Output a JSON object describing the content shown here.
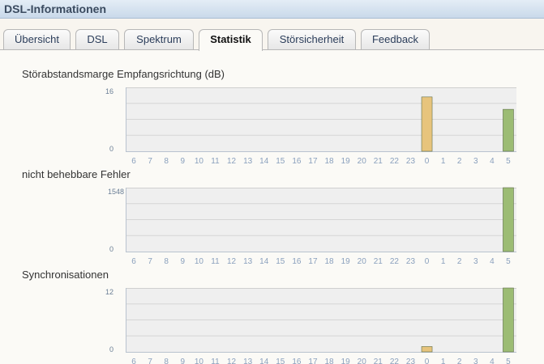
{
  "window_title": "DSL-Informationen",
  "tabs": [
    {
      "label": "Übersicht",
      "active": false
    },
    {
      "label": "DSL",
      "active": false
    },
    {
      "label": "Spektrum",
      "active": false
    },
    {
      "label": "Statistik",
      "active": true
    },
    {
      "label": "Störsicherheit",
      "active": false
    },
    {
      "label": "Feedback",
      "active": false
    }
  ],
  "colors": {
    "bar_orange": "#e7c47c",
    "bar_green": "#9cbc74",
    "plot_bg": "#efefef",
    "tick_text": "#8aa0bd",
    "axis_text": "#6b7f96"
  },
  "charts": [
    {
      "title": "Störabstandsmarge Empfangsrichtung (dB)",
      "ymax_label": "16",
      "ymin_label": "0"
    },
    {
      "title": "nicht behebbare Fehler",
      "ymax_label": "1548",
      "ymin_label": "0"
    },
    {
      "title": "Synchronisationen",
      "ymax_label": "12",
      "ymin_label": "0"
    }
  ],
  "chart_data": [
    {
      "type": "bar",
      "title": "Störabstandsmarge Empfangsrichtung (dB)",
      "categories": [
        "6",
        "7",
        "8",
        "9",
        "10",
        "11",
        "12",
        "13",
        "14",
        "15",
        "16",
        "17",
        "18",
        "19",
        "20",
        "21",
        "22",
        "23",
        "0",
        "1",
        "2",
        "3",
        "4",
        "5"
      ],
      "values": [
        null,
        null,
        null,
        null,
        null,
        null,
        null,
        null,
        null,
        null,
        null,
        null,
        null,
        null,
        null,
        null,
        null,
        null,
        13.6,
        null,
        null,
        null,
        null,
        10.5
      ],
      "bar_colors": {
        "0": "#e7c47c",
        "5": "#9cbc74"
      },
      "ylim": [
        0,
        16
      ]
    },
    {
      "type": "bar",
      "title": "nicht behebbare Fehler",
      "categories": [
        "6",
        "7",
        "8",
        "9",
        "10",
        "11",
        "12",
        "13",
        "14",
        "15",
        "16",
        "17",
        "18",
        "19",
        "20",
        "21",
        "22",
        "23",
        "0",
        "1",
        "2",
        "3",
        "4",
        "5"
      ],
      "values": [
        null,
        null,
        null,
        null,
        null,
        null,
        null,
        null,
        null,
        null,
        null,
        null,
        null,
        null,
        null,
        null,
        null,
        null,
        0,
        null,
        null,
        null,
        null,
        1548
      ],
      "bar_colors": {
        "0": "#e7c47c",
        "5": "#9cbc74"
      },
      "ylim": [
        0,
        1548
      ]
    },
    {
      "type": "bar",
      "title": "Synchronisationen",
      "categories": [
        "6",
        "7",
        "8",
        "9",
        "10",
        "11",
        "12",
        "13",
        "14",
        "15",
        "16",
        "17",
        "18",
        "19",
        "20",
        "21",
        "22",
        "23",
        "0",
        "1",
        "2",
        "3",
        "4",
        "5"
      ],
      "values": [
        null,
        null,
        null,
        null,
        null,
        null,
        null,
        null,
        null,
        null,
        null,
        null,
        null,
        null,
        null,
        null,
        null,
        null,
        1,
        null,
        null,
        null,
        null,
        12
      ],
      "bar_colors": {
        "0": "#e7c47c",
        "5": "#9cbc74"
      },
      "ylim": [
        0,
        12
      ]
    }
  ]
}
